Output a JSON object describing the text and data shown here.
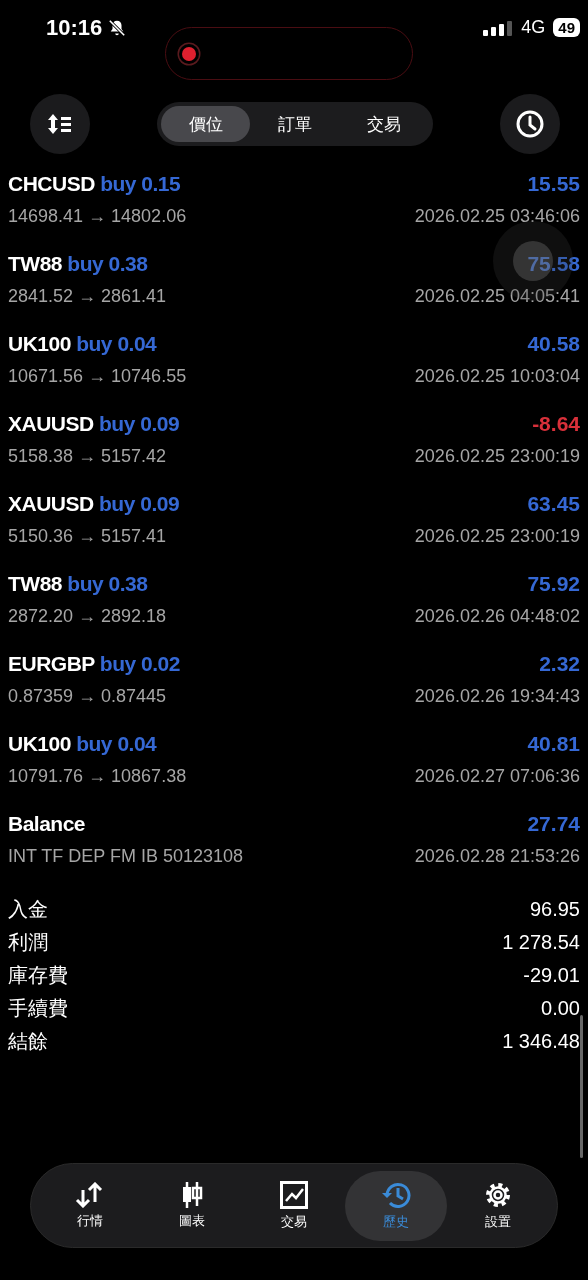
{
  "status_bar": {
    "time": "10:16",
    "network": "4G",
    "battery": "49"
  },
  "header": {
    "tabs": [
      {
        "label": "價位",
        "selected": true
      },
      {
        "label": "訂單",
        "selected": false
      },
      {
        "label": "交易",
        "selected": false
      }
    ]
  },
  "deals": [
    {
      "kind": "trade",
      "symbol": "CHCUSD",
      "side": "buy 0.15",
      "profit": "15.55",
      "loss": false,
      "prices": "14698.41 → 14802.06",
      "time": "2026.02.25 03:46:06"
    },
    {
      "kind": "trade",
      "symbol": "TW88",
      "side": "buy 0.38",
      "profit": "75.58",
      "loss": false,
      "prices": "2841.52 → 2861.41",
      "time": "2026.02.25 04:05:41"
    },
    {
      "kind": "trade",
      "symbol": "UK100",
      "side": "buy 0.04",
      "profit": "40.58",
      "loss": false,
      "prices": "10671.56 → 10746.55",
      "time": "2026.02.25 10:03:04"
    },
    {
      "kind": "trade",
      "symbol": "XAUUSD",
      "side": "buy 0.09",
      "profit": "-8.64",
      "loss": true,
      "prices": "5158.38 → 5157.42",
      "time": "2026.02.25 23:00:19"
    },
    {
      "kind": "trade",
      "symbol": "XAUUSD",
      "side": "buy 0.09",
      "profit": "63.45",
      "loss": false,
      "prices": "5150.36 → 5157.41",
      "time": "2026.02.25 23:00:19"
    },
    {
      "kind": "trade",
      "symbol": "TW88",
      "side": "buy 0.38",
      "profit": "75.92",
      "loss": false,
      "prices": "2872.20 → 2892.18",
      "time": "2026.02.26 04:48:02"
    },
    {
      "kind": "trade",
      "symbol": "EURGBP",
      "side": "buy 0.02",
      "profit": "2.32",
      "loss": false,
      "prices": "0.87359 → 0.87445",
      "time": "2026.02.26 19:34:43"
    },
    {
      "kind": "trade",
      "symbol": "UK100",
      "side": "buy 0.04",
      "profit": "40.81",
      "loss": false,
      "prices": "10791.76 → 10867.38",
      "time": "2026.02.27 07:06:36"
    },
    {
      "kind": "balance",
      "symbol": "Balance",
      "profit": "27.74",
      "loss": false,
      "prices": "INT TF DEP FM IB 50123108",
      "time": "2026.02.28 21:53:26"
    }
  ],
  "summary": [
    {
      "label": "入金",
      "value": "96.95"
    },
    {
      "label": "利潤",
      "value": "1 278.54"
    },
    {
      "label": "庫存費",
      "value": "-29.01"
    },
    {
      "label": "手續費",
      "value": "0.00"
    },
    {
      "label": "結餘",
      "value": "1 346.48"
    }
  ],
  "bottom_nav": [
    {
      "kind": "quotes",
      "label": "行情",
      "selected": false
    },
    {
      "kind": "chart",
      "label": "圖表",
      "selected": false
    },
    {
      "kind": "trade",
      "label": "交易",
      "selected": false
    },
    {
      "kind": "history",
      "label": "歷史",
      "selected": true
    },
    {
      "kind": "settings",
      "label": "設置",
      "selected": false
    }
  ]
}
